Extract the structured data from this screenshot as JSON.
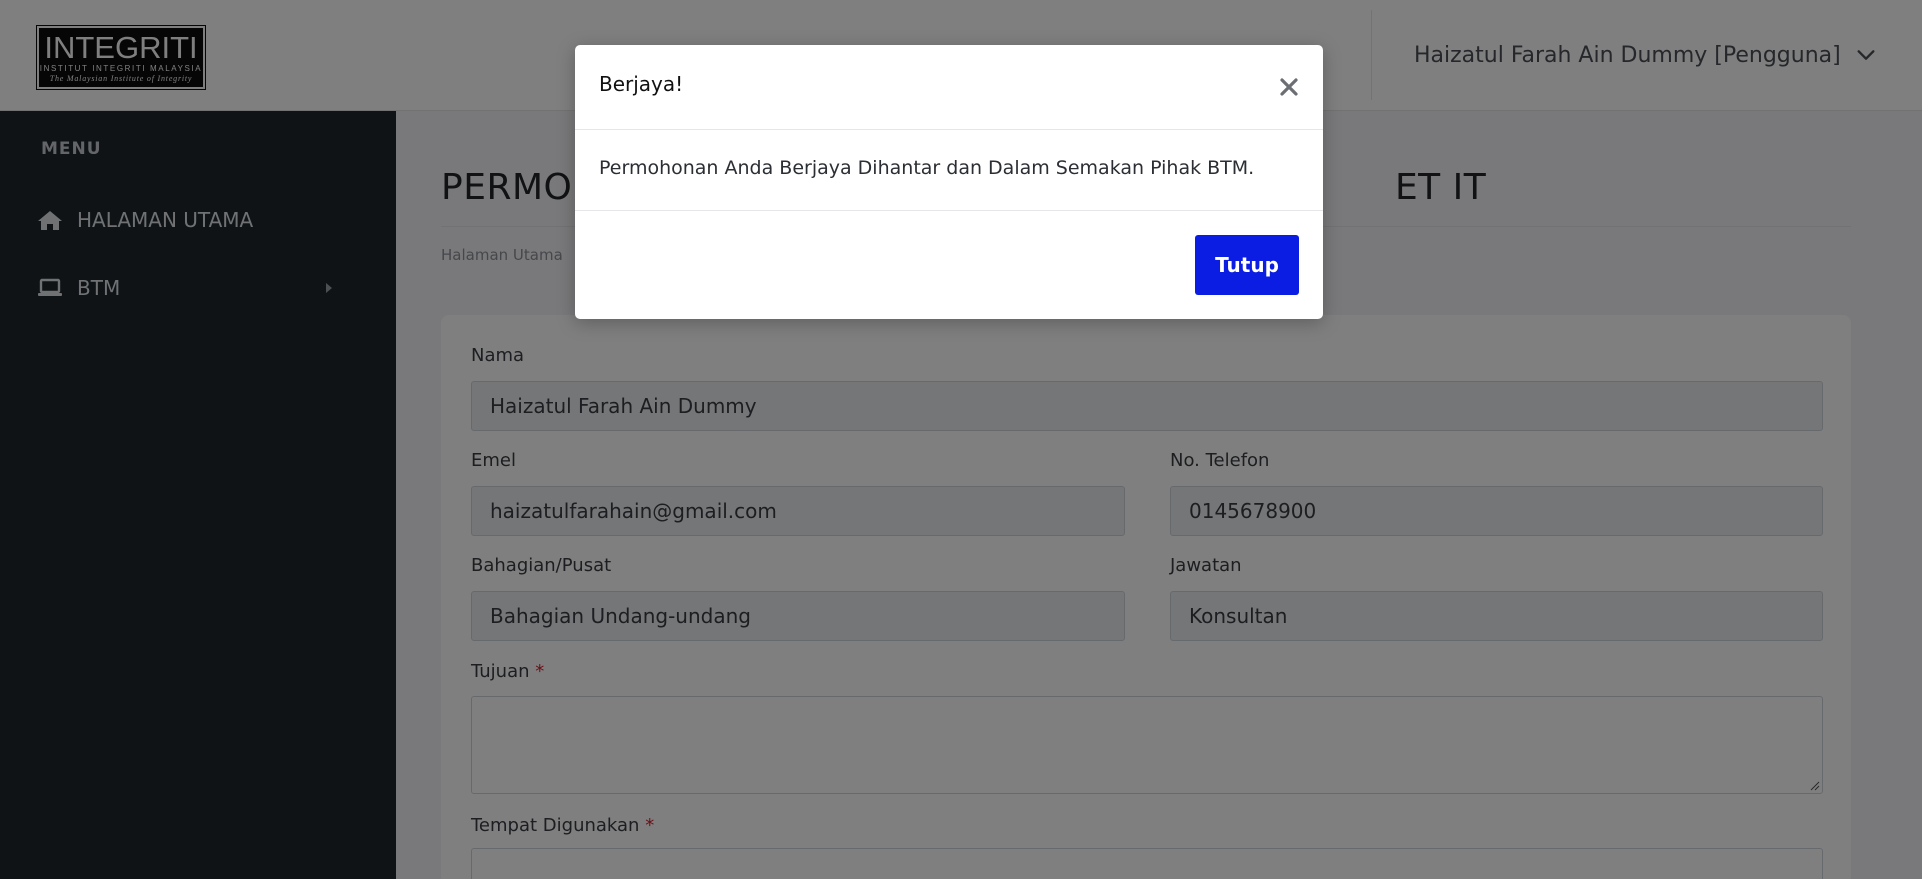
{
  "header": {
    "logo": {
      "title": "INTEGRITI",
      "line2": "INSTITUT INTEGRITI MALAYSIA",
      "line3": "The Malaysian Institute of Integrity"
    },
    "user_label": "Haizatul Farah Ain Dummy [Pengguna]"
  },
  "sidebar": {
    "menu_title": "MENU",
    "items": [
      {
        "label": "HALAMAN UTAMA",
        "icon": "home-icon"
      },
      {
        "label": "BTM",
        "icon": "laptop-icon"
      }
    ]
  },
  "main": {
    "page_title_left": "PERMOH",
    "page_title_right": "ET IT",
    "breadcrumb": "Halaman Utama",
    "form": {
      "nama_label": "Nama",
      "nama_value": "Haizatul Farah Ain Dummy",
      "emel_label": "Emel",
      "emel_value": "haizatulfarahain@gmail.com",
      "telefon_label": "No. Telefon",
      "telefon_value": "0145678900",
      "bahagian_label": "Bahagian/Pusat",
      "bahagian_value": "Bahagian Undang-undang",
      "jawatan_label": "Jawatan",
      "jawatan_value": "Konsultan",
      "tujuan_label": "Tujuan",
      "tempat_label": "Tempat Digunakan",
      "required_mark": "*"
    }
  },
  "modal": {
    "title": "Berjaya!",
    "message": "Permohonan Anda Berjaya Dihantar dan Dalam Semakan Pihak BTM.",
    "close_button_label": "Tutup"
  },
  "colors": {
    "primary_button": "#0b1de3",
    "sidebar_bg": "#1e262d",
    "required": "#d6202e"
  }
}
